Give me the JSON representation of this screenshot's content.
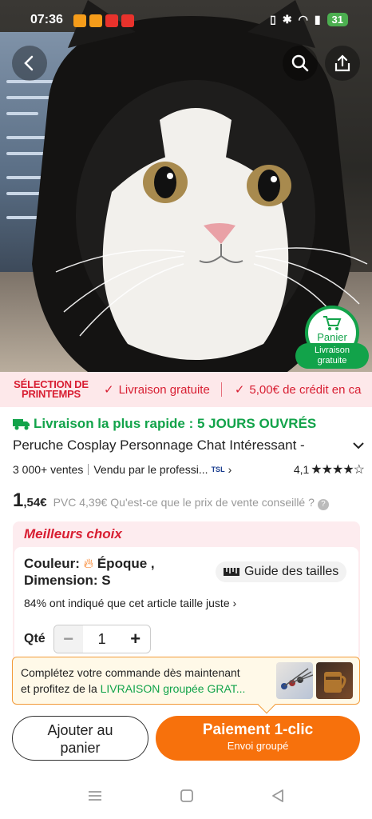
{
  "status_bar": {
    "time": "07:36",
    "battery": "31",
    "notif_colors": [
      "#f59c1a",
      "#f59c1a",
      "#e8322c",
      "#e8322c"
    ]
  },
  "nav": {
    "back_icon": "chevron-left-icon",
    "search_icon": "search-icon",
    "share_icon": "share-icon"
  },
  "cart_badge": {
    "label": "Panier",
    "free_line1": "Livraison",
    "free_line2": "gratuite"
  },
  "promo": {
    "brand_line1": "SÉLECTION DE",
    "brand_line2": "PRINTEMPS",
    "item1": "Livraison gratuite",
    "item2": "5,00€ de crédit en ca"
  },
  "product": {
    "fast_delivery": "Livraison la plus rapide : 5 JOURS OUVRÉS",
    "title": "Peruche Cosplay Personnage Chat Intéressant -",
    "sales": "3 000+ ventes",
    "seller": "Vendu par le professi...",
    "seller_badge": "TSL",
    "rating": "4,1",
    "stars": "★★★★☆",
    "price_int": "1",
    "price_dec": ",54€",
    "pvc_label": "PVC",
    "pvc_value": "4,39€",
    "pvc_question": "Qu'est-ce que le prix de vente conseillé ?"
  },
  "best_choice": {
    "heading": "Meilleurs choix",
    "color_label": "Couleur:",
    "color_value": "Époque ,",
    "dimension_label": "Dimension:",
    "dimension_value": "S",
    "size_guide": "Guide des tailles",
    "fit_text": "84% ont indiqué que cet article taille juste",
    "qty_label": "Qté",
    "qty_value": "1"
  },
  "group_banner": {
    "line1": "Complétez votre commande dès maintenant",
    "line2_prefix": "et profitez de la ",
    "line2_highlight": "LIVRAISON groupée GRAT..."
  },
  "buttons": {
    "add_cart_line1": "Ajouter au",
    "add_cart_line2": "panier",
    "buy_main": "Paiement 1-clic",
    "buy_sub": "Envoi groupé"
  },
  "colors": {
    "accent_orange": "#f7710c",
    "green": "#12a34a",
    "promo_red": "#d81e32"
  }
}
